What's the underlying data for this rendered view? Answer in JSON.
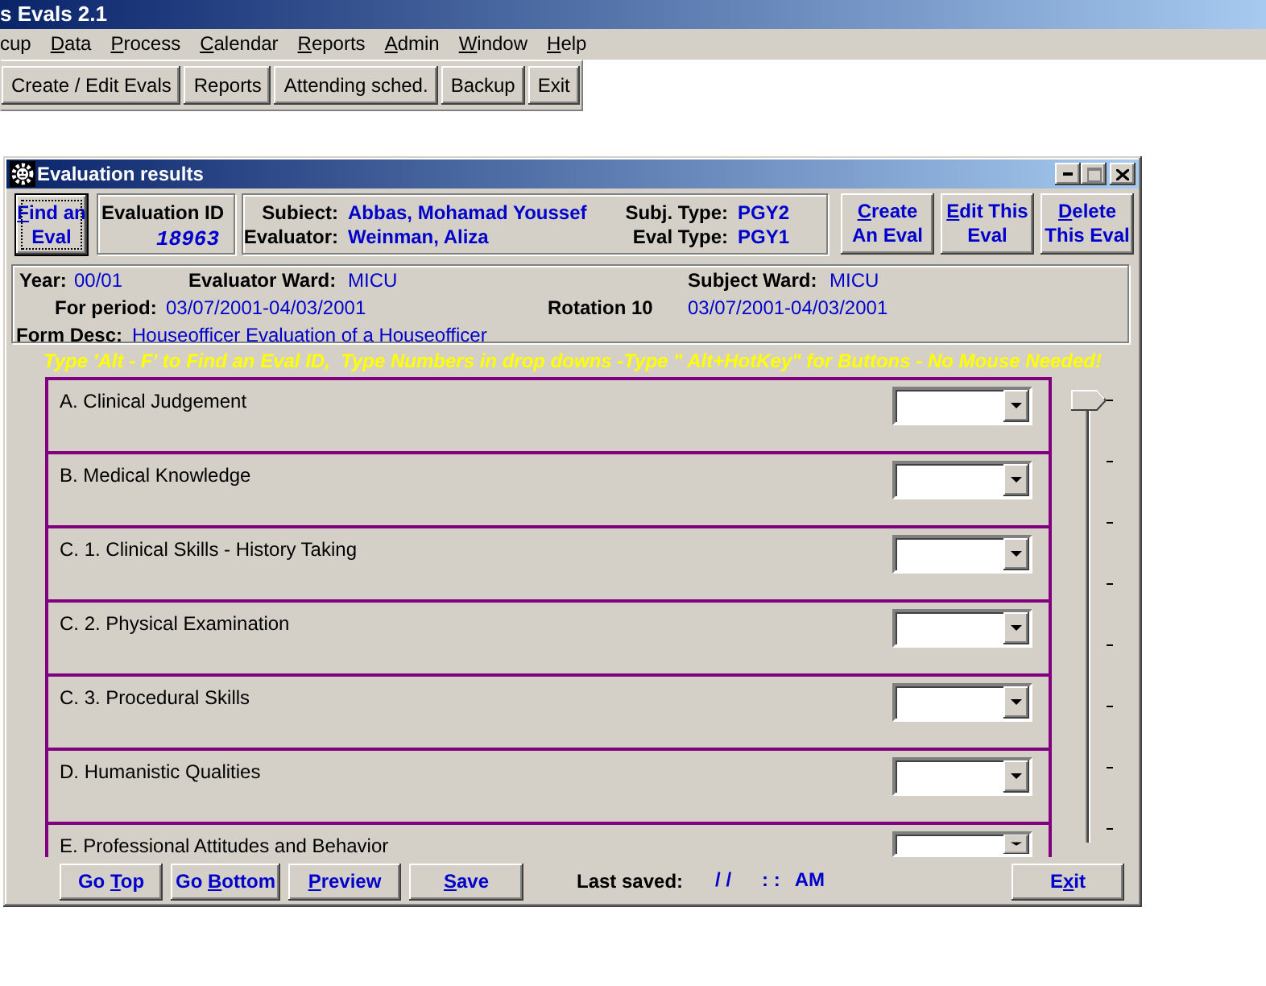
{
  "app": {
    "title": "s Evals 2.1"
  },
  "menu": [
    {
      "before": "cup"
    },
    {
      "key": "D",
      "after": "ata"
    },
    {
      "key": "P",
      "after": "rocess"
    },
    {
      "key": "C",
      "after": "alendar"
    },
    {
      "key": "R",
      "after": "eports"
    },
    {
      "key": "A",
      "after": "dmin"
    },
    {
      "key": "W",
      "after": "indow"
    },
    {
      "key": "H",
      "after": "elp"
    }
  ],
  "toolbar": [
    "Create / Edit Evals",
    "Reports",
    "Attending sched.",
    "Backup",
    "Exit"
  ],
  "dialog": {
    "title": "Evaluation results",
    "window_buttons": [
      {
        "kind": "minimize",
        "disabled": false
      },
      {
        "kind": "maximize",
        "disabled": true
      },
      {
        "kind": "close",
        "disabled": false
      }
    ],
    "find_button": {
      "key": "F",
      "after": "ind an\nEval",
      "focused": true
    },
    "evaluation_id": {
      "label": "Evaluation ID",
      "value": "18963"
    },
    "subject": {
      "label": "Subiect:",
      "value": "Abbas, Mohamad Youssef"
    },
    "evaluator": {
      "label": "Evaluator:",
      "value": "Weinman, Aliza"
    },
    "subject_type": {
      "label": "Subj. Type:",
      "value": "PGY2"
    },
    "eval_type": {
      "label": "Eval Type:",
      "value": "PGY1"
    },
    "actions": [
      {
        "key": "C",
        "after": "reate\nAn Eval"
      },
      {
        "key": "E",
        "after": "dit This\nEval"
      },
      {
        "key": "D",
        "after": "elete\nThis Eval"
      }
    ],
    "info": {
      "year": {
        "label": "Year:",
        "value": "00/01"
      },
      "evaluator_ward": {
        "label": "Evaluator Ward:",
        "value": "MICU"
      },
      "subject_ward": {
        "label": "Subject Ward:",
        "value": "MICU"
      },
      "for_period": {
        "label": "For period:",
        "value": "03/07/2001-04/03/2001"
      },
      "rotation": {
        "label": "Rotation 10",
        "value": "03/07/2001-04/03/2001"
      },
      "form_desc": {
        "label": "Form Desc:",
        "value": "Houseofficer Evaluation of a Houseofficer"
      }
    },
    "hint": "Type 'Alt - F' to Find an Eval ID,  Type Numbers in drop downs -Type \" Alt+HotKey\" for Buttons - No Mouse Needed!",
    "criteria": [
      "A. Clinical Judgement",
      "B. Medical Knowledge",
      "C. 1. Clinical Skills - History Taking",
      "C. 2. Physical Examination",
      "C. 3. Procedural Skills",
      "D. Humanistic Qualities",
      "E. Professional Attitudes and Behavior"
    ],
    "scroll_slider": {
      "level": 0
    },
    "footer_buttons": [
      {
        "before": "Go ",
        "key": "T",
        "after": "op"
      },
      {
        "before": "Go ",
        "key": "B",
        "after": "ottom"
      },
      {
        "key": "P",
        "after": "review"
      },
      {
        "key": "S",
        "after": "ave"
      }
    ],
    "last_saved": {
      "label": "Last saved:",
      "date": "/ /",
      "time": ": :",
      "meridiem": "AM"
    },
    "exit_button": {
      "before": "E",
      "key": "x",
      "after": "it"
    }
  }
}
